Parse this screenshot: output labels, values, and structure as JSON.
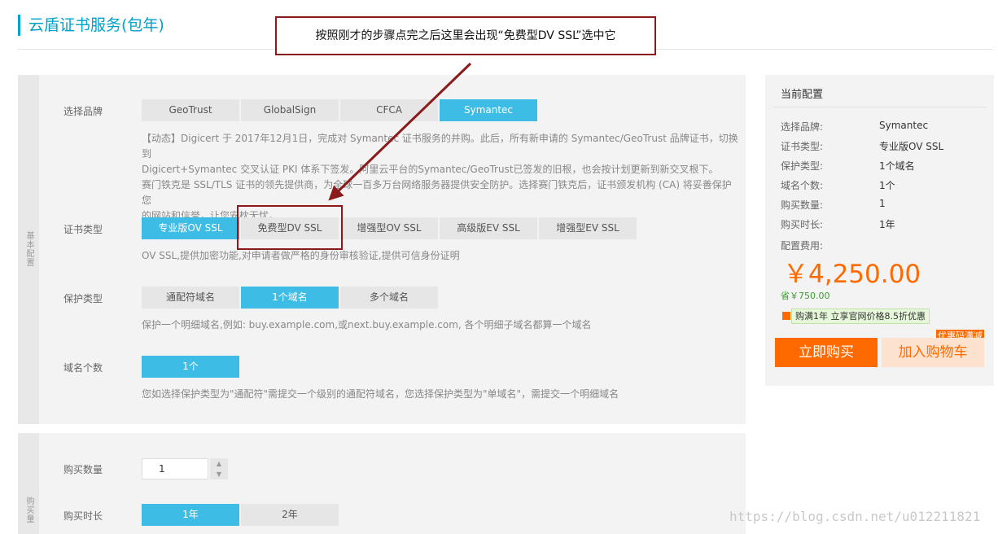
{
  "page": {
    "title": "云盾证书服务(包年)"
  },
  "callout": {
    "text": "按照刚才的步骤点完之后这里会出现“免费型DV SSL”选中它"
  },
  "basic": {
    "section_label": "基本配置",
    "brand": {
      "label": "选择品牌",
      "options": [
        "GeoTrust",
        "GlobalSign",
        "CFCA",
        "Symantec"
      ],
      "selected": "Symantec",
      "desc": [
        "【动态】Digicert 于 2017年12月1日，完成对 Symantec 证书服务的并购。此后，所有新申请的 Symantec/GeoTrust 品牌证书，切换到",
        "Digicert+Symantec 交叉认证 PKI 体系下签发。阿里云平台的Symantec/GeoTrust已签发的旧根，也会按计划更新到新交叉根下。",
        "赛门铁克是 SSL/TLS 证书的领先提供商，为全球一百多万台网络服务器提供安全防护。选择赛门铁克后，证书颁发机构 (CA) 将妥善保护您",
        "的网站和信誉，让您安枕无忧。"
      ]
    },
    "cert_type": {
      "label": "证书类型",
      "options": [
        "专业版OV SSL",
        "免费型DV SSL",
        "增强型OV SSL",
        "高级版EV SSL",
        "增强型EV SSL"
      ],
      "selected": "专业版OV SSL",
      "desc": "OV SSL,提供加密功能,对申请者做严格的身份审核验证,提供可信身份证明"
    },
    "protect": {
      "label": "保护类型",
      "options": [
        "通配符域名",
        "1个域名",
        "多个域名"
      ],
      "selected": "1个域名",
      "desc": "保护一个明细域名,例如: buy.example.com,或next.buy.example.com, 各个明细子域名都算一个域名"
    },
    "domains": {
      "label": "域名个数",
      "value": "1个",
      "desc": "您如选择保护类型为\"通配符\"需提交一个级别的通配符域名，您选择保护类型为\"单域名\"，需提交一个明细域名"
    }
  },
  "purchase": {
    "section_label": "购买量",
    "qty": {
      "label": "购买数量",
      "value": "1"
    },
    "duration": {
      "label": "购买时长",
      "options": [
        "1年",
        "2年"
      ],
      "selected": "1年"
    }
  },
  "config": {
    "title": "当前配置",
    "items": [
      {
        "k": "选择品牌:",
        "v": "Symantec"
      },
      {
        "k": "证书类型:",
        "v": "专业版OV SSL"
      },
      {
        "k": "保护类型:",
        "v": "1个域名"
      },
      {
        "k": "域名个数:",
        "v": "1个"
      },
      {
        "k": "购买数量:",
        "v": "1"
      },
      {
        "k": "购买时长:",
        "v": "1年"
      }
    ],
    "fee_label": "配置费用:",
    "price": "￥4,250.00",
    "save": "省￥750.00",
    "promo": "购满1年 立享官网价格8.5折优惠",
    "coupon": "优惠码满减",
    "buy": "立即购买",
    "cart": "加入购物车"
  },
  "watermark": "https://blog.csdn.net/u012211821",
  "colors": {
    "accent": "#3dbde6",
    "orange": "#ff6a00",
    "annotation": "#8b1a1a"
  }
}
